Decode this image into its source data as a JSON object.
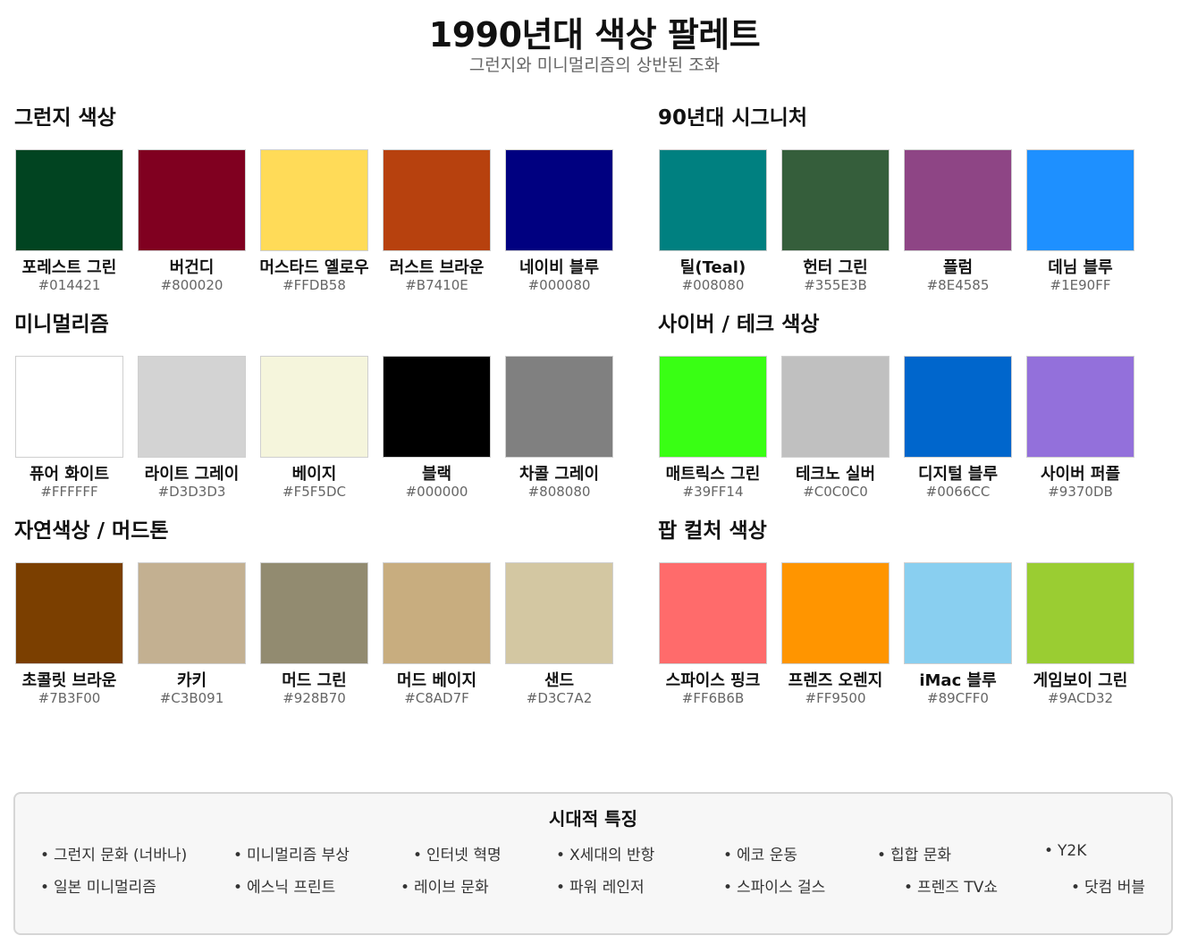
{
  "header": {
    "title": "1990년대 색상 팔레트",
    "subtitle": "그런지와 미니멀리즘의 상반된 조화"
  },
  "sections": [
    {
      "title": "그런지 색상",
      "colors": [
        {
          "name": "포레스트 그린",
          "hex": "#014421"
        },
        {
          "name": "버건디",
          "hex": "#800020"
        },
        {
          "name": "머스타드 옐로우",
          "hex": "#FFDB58"
        },
        {
          "name": "러스트 브라운",
          "hex": "#B7410E"
        },
        {
          "name": "네이비 블루",
          "hex": "#000080"
        }
      ]
    },
    {
      "title": "90년대 시그니처",
      "colors": [
        {
          "name": "틸(Teal)",
          "hex": "#008080"
        },
        {
          "name": "헌터 그린",
          "hex": "#355E3B"
        },
        {
          "name": "플럼",
          "hex": "#8E4585"
        },
        {
          "name": "데님 블루",
          "hex": "#1E90FF"
        }
      ]
    },
    {
      "title": "미니멀리즘",
      "colors": [
        {
          "name": "퓨어 화이트",
          "hex": "#FFFFFF"
        },
        {
          "name": "라이트 그레이",
          "hex": "#D3D3D3"
        },
        {
          "name": "베이지",
          "hex": "#F5F5DC"
        },
        {
          "name": "블랙",
          "hex": "#000000"
        },
        {
          "name": "차콜 그레이",
          "hex": "#808080"
        }
      ]
    },
    {
      "title": "사이버 / 테크 색상",
      "colors": [
        {
          "name": "매트릭스 그린",
          "hex": "#39FF14"
        },
        {
          "name": "테크노 실버",
          "hex": "#C0C0C0"
        },
        {
          "name": "디지털 블루",
          "hex": "#0066CC"
        },
        {
          "name": "사이버 퍼플",
          "hex": "#9370DB"
        }
      ]
    },
    {
      "title": "자연색상 / 머드톤",
      "colors": [
        {
          "name": "초콜릿 브라운",
          "hex": "#7B3F00"
        },
        {
          "name": "카키",
          "hex": "#C3B091"
        },
        {
          "name": "머드 그린",
          "hex": "#928B70"
        },
        {
          "name": "머드 베이지",
          "hex": "#C8AD7F"
        },
        {
          "name": "샌드",
          "hex": "#D3C7A2"
        }
      ]
    },
    {
      "title": "팝 컬처 색상",
      "colors": [
        {
          "name": "스파이스 핑크",
          "hex": "#FF6B6B"
        },
        {
          "name": "프렌즈 오렌지",
          "hex": "#FF9500"
        },
        {
          "name": "iMac 블루",
          "hex": "#89CFF0"
        },
        {
          "name": "게임보이 그린",
          "hex": "#9ACD32"
        }
      ]
    }
  ],
  "features": {
    "title": "시대적 특징",
    "row1": [
      "그런지 문화 (너바나)",
      "미니멀리즘 부상",
      "인터넷 혁명",
      "X세대의 반항",
      "에코 운동",
      "힙합 문화",
      "Y2K"
    ],
    "row2": [
      "일본 미니멀리즘",
      "에스닉 프린트",
      "레이브 문화",
      "파워 레인저",
      "스파이스 걸스",
      "프렌즈 TV쇼",
      "닷컴 버블"
    ]
  }
}
